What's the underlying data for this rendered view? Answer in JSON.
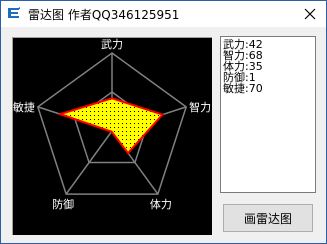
{
  "window": {
    "title": "雷达图 作者QQ346125951"
  },
  "radar": {
    "axis_labels": [
      "武力",
      "智力",
      "体力",
      "防御",
      "敏捷"
    ],
    "values": [
      42,
      68,
      35,
      1,
      70
    ],
    "max": 100,
    "colors": {
      "background": "#000000",
      "grid": "#808080",
      "fill": "#ffff00",
      "outline": "#ff0000",
      "label": "#ffffff"
    }
  },
  "stats": {
    "lines": [
      "武力:42",
      "智力:68",
      "体力:35",
      "防御:1",
      "敏捷:70"
    ]
  },
  "buttons": {
    "draw_label": "画雷达图"
  },
  "icons": {
    "app": "app-logo-icon",
    "close": "close-icon"
  }
}
